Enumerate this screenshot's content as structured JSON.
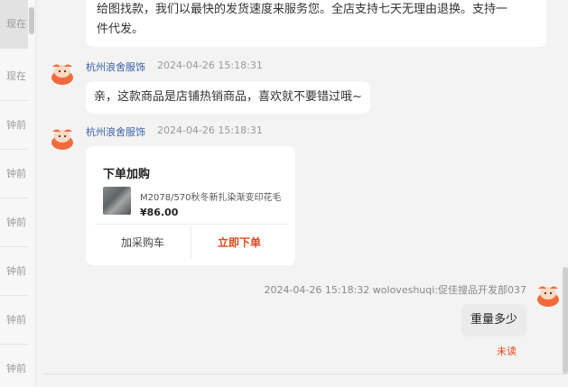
{
  "left_list": {
    "items": [
      {
        "time": "现在",
        "active": true
      },
      {
        "time": "现在",
        "active": false
      },
      {
        "time": "钟前",
        "active": false
      },
      {
        "time": "钟前",
        "active": false
      },
      {
        "time": "钟前",
        "active": false
      },
      {
        "time": "钟前",
        "active": false
      },
      {
        "time": "钟前",
        "active": false
      },
      {
        "time": "钟前",
        "active": false
      }
    ]
  },
  "messages": {
    "top_text_line1": "给图找款，我们以最快的发货速度来服务您。全店支持七天无理由退换。支持一",
    "top_text_line2": "件代发。",
    "msg2_sender": "杭州浪舍服饰",
    "msg2_time": "2024-04-26 15:18:31",
    "msg2_text": "亲，这款商品是店铺热销商品，喜欢就不要错过哦~",
    "msg3_sender": "杭州浪舍服饰",
    "msg3_time": "2024-04-26 15:18:31",
    "card": {
      "title": "下单加购",
      "product_name": "M2078/570秋冬新扎染渐变印花毛",
      "price": "¥86.00",
      "add_cart_label": "加采购车",
      "buy_now_label": "立即下单"
    },
    "my_meta": "2024-04-26 15:18:32  woloveshuqi:促佳搜品开发部037",
    "my_text": "重量多少",
    "unread_label": "未读"
  },
  "colors": {
    "sender": "#3a61a8",
    "accent": "#e2481e"
  }
}
